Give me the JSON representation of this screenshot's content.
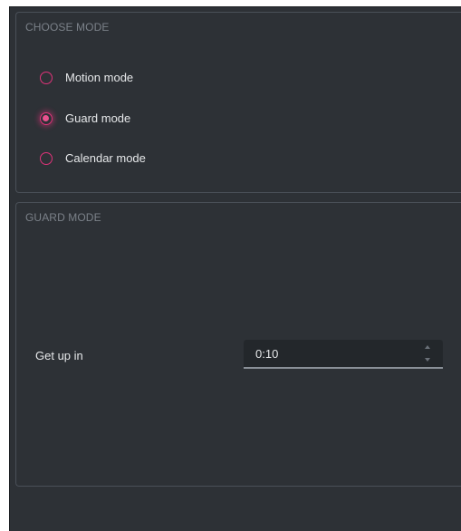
{
  "choose_mode": {
    "title": "CHOOSE MODE",
    "options": [
      {
        "label": "Motion mode",
        "checked": false
      },
      {
        "label": "Guard mode",
        "checked": true
      },
      {
        "label": "Calendar mode",
        "checked": false
      }
    ]
  },
  "guard_mode": {
    "title": "GUARD MODE",
    "get_up_label": "Get up in",
    "get_up_value": "0:10"
  },
  "colors": {
    "background": "#2d3136",
    "accent": "#e0337a",
    "text": "#e6e8ea",
    "muted_text": "#7b8189"
  }
}
